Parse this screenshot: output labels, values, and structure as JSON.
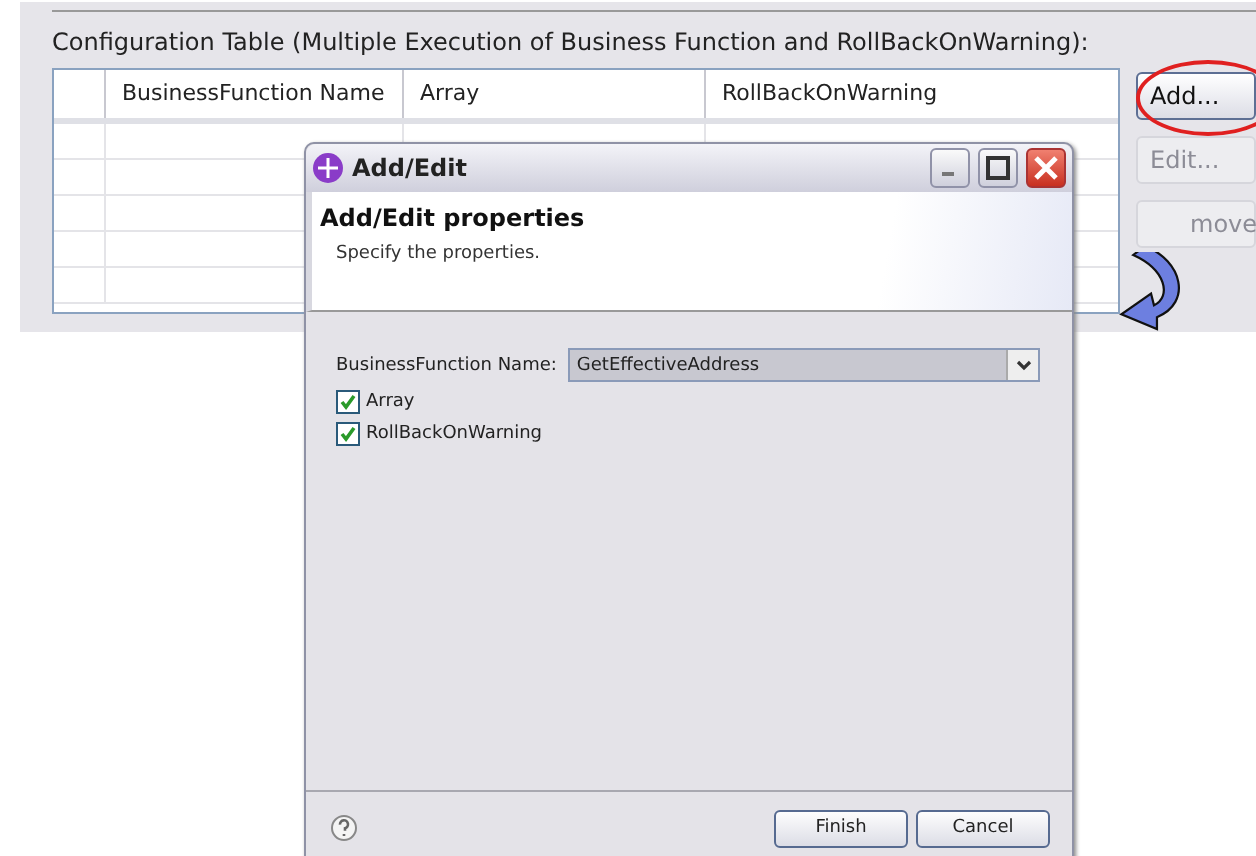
{
  "panel": {
    "title": "Configuration Table (Multiple Execution of Business Function and RollBackOnWarning):",
    "columns": [
      "BusinessFunction Name",
      "Array",
      "RollBackOnWarning"
    ],
    "buttons": [
      {
        "label": "Add...",
        "disabled": false,
        "highlighted": true
      },
      {
        "label": "Edit...",
        "disabled": true,
        "highlighted": false
      },
      {
        "label": "move",
        "disabled": true,
        "highlighted": false
      }
    ]
  },
  "dialog": {
    "title": "Add/Edit",
    "heading": "Add/Edit properties",
    "description": "Specify the properties.",
    "field": {
      "label": "BusinessFunction Name:",
      "value": "GetEffectiveAddress"
    },
    "checkboxes": [
      {
        "label": "Array",
        "checked": true
      },
      {
        "label": "RollBackOnWarning",
        "checked": true
      }
    ],
    "buttons": [
      "Finish",
      "Cancel"
    ]
  }
}
